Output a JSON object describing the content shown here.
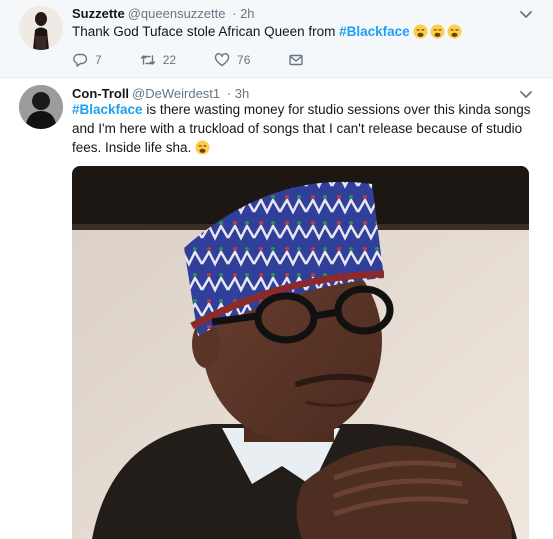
{
  "tweets": [
    {
      "name": "Suzzette",
      "handle": "@queensuzzette",
      "time": "· 2h",
      "text_before": "Thank God Tuface stole African Queen from ",
      "hashtag": "#Blackface",
      "emoji": "weary-face-emoji x3",
      "actions": {
        "reply_count": "7",
        "retweet_count": "22",
        "like_count": "76"
      }
    },
    {
      "name": "Con-Troll",
      "handle": "@DeWeirdest1",
      "time": "· 3h",
      "hashtag": "#Blackface",
      "text_after": " is there wasting money for studio sessions over this kinda songs and I'm here with a truckload of songs that I can't release because of studio fees. Inside life sha. ",
      "emoji": "weary-face-emoji",
      "image": "photo-of-man-in-embroidered-cap-and-glasses"
    }
  ],
  "colors": {
    "hashtag": "#1da1f2",
    "meta_text": "#657786",
    "tweet_1_background": "#f5f8fa"
  }
}
